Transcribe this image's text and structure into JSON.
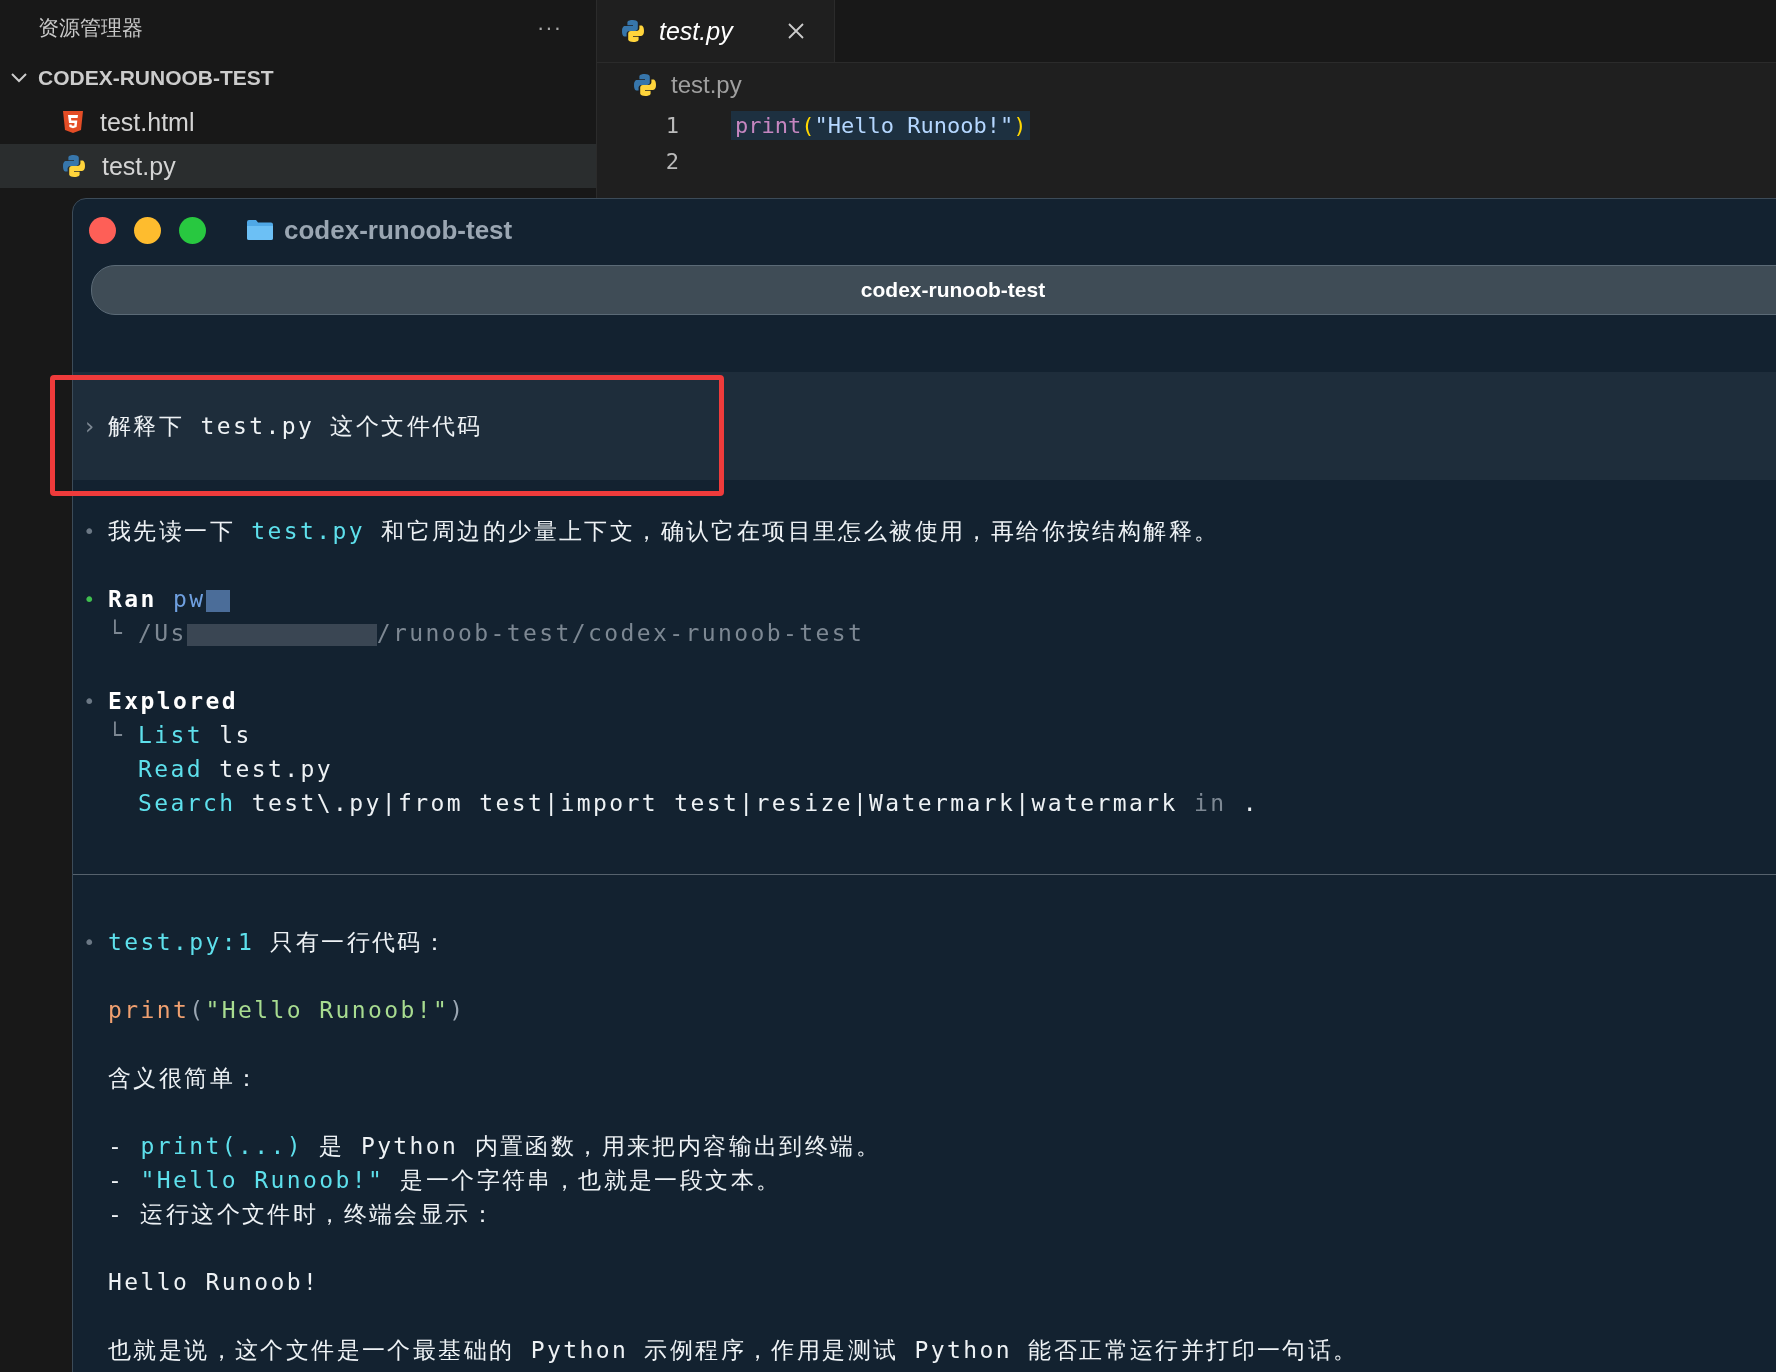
{
  "sidebar": {
    "title": "资源管理器",
    "more": "···",
    "folder": {
      "name": "CODEX-RUNOOB-TEST",
      "expanded": true
    },
    "files": [
      {
        "name": "test.html",
        "kind": "html",
        "selected": false
      },
      {
        "name": "test.py",
        "kind": "python",
        "selected": true
      }
    ]
  },
  "editor": {
    "tab": {
      "label": "test.py"
    },
    "breadcrumb": "test.py",
    "lines": [
      {
        "number": "1",
        "segments": [
          {
            "text": "print",
            "kind": "func"
          },
          {
            "text": "(",
            "kind": "paren"
          },
          {
            "text": "\"Hello Runoob!\"",
            "kind": "string"
          },
          {
            "text": ")",
            "kind": "paren"
          }
        ]
      },
      {
        "number": "2"
      }
    ]
  },
  "terminal": {
    "title": "codex-runoob-test",
    "tab": "codex-runoob-test",
    "blocks": [
      {
        "kind": "prompt",
        "marker": "›",
        "lines": [
          {
            "segments": [
              {
                "text": "解释下 test.py 这个文件代码",
                "kind": "plain"
              }
            ]
          }
        ]
      },
      {
        "kind": "bullet",
        "marker": "•",
        "color": "#6b7885",
        "lines": [
          {
            "segments": [
              {
                "text": "我先读一下 ",
                "kind": "plain"
              },
              {
                "text": "test.py",
                "kind": "accent"
              },
              {
                "text": " 和它周边的少量上下文，确认它在项目里怎么被使用，再给你按结构解释。",
                "kind": "plain"
              }
            ]
          }
        ]
      },
      {
        "kind": "bullet",
        "marker": "•",
        "color": "#3fbf4f",
        "lines": [
          {
            "segments": [
              {
                "text": "Ran",
                "kind": "bold"
              },
              {
                "text": " pw",
                "kind": "command"
              },
              {
                "kind": "redacted"
              }
            ]
          },
          {
            "tree": "└",
            "segments": [
              {
                "text": "/Us",
                "kind": "dim"
              },
              {
                "kind": "redacted"
              },
              {
                "text": "/runoob-test/codex-runoob-test",
                "kind": "dim"
              }
            ]
          }
        ]
      },
      {
        "kind": "bullet",
        "marker": "•",
        "color": "#6b7885",
        "lines": [
          {
            "segments": [
              {
                "text": "Explored",
                "kind": "bold"
              }
            ]
          },
          {
            "tree": "└",
            "segments": [
              {
                "text": "List",
                "kind": "accent"
              },
              {
                "text": " ls",
                "kind": "plain"
              }
            ]
          },
          {
            "segments": [
              {
                "text": "Read",
                "kind": "accent"
              },
              {
                "text": " test.py",
                "kind": "plain"
              }
            ]
          },
          {
            "segments": [
              {
                "text": "Search",
                "kind": "accent"
              },
              {
                "text": " test\\.py|from test|import test|resize|Watermark|watermark ",
                "kind": "plain"
              },
              {
                "text": "in",
                "kind": "dim"
              },
              {
                "text": " .",
                "kind": "plain"
              }
            ]
          }
        ]
      },
      {
        "kind": "divider"
      },
      {
        "kind": "bullet",
        "marker": "•",
        "color": "#6b7885",
        "lines": [
          {
            "segments": [
              {
                "text": "test.py:1",
                "kind": "accent"
              },
              {
                "text": " 只有一行代码：",
                "kind": "plain"
              }
            ]
          }
        ]
      },
      {
        "kind": "text",
        "lines": [
          {
            "segments": [
              {
                "text": "print",
                "kind": "func"
              },
              {
                "text": "(",
                "kind": "paren"
              },
              {
                "text": "\"Hello Runoob!\"",
                "kind": "string"
              },
              {
                "text": ")",
                "kind": "paren"
              }
            ]
          }
        ]
      },
      {
        "kind": "text",
        "lines": [
          {
            "segments": [
              {
                "text": "含义很简单：",
                "kind": "plain"
              }
            ]
          }
        ]
      },
      {
        "kind": "text",
        "lines": [
          {
            "segments": [
              {
                "text": "- ",
                "kind": "plain"
              },
              {
                "text": "print(...)",
                "kind": "accent"
              },
              {
                "text": " 是 Python 内置函数，用来把内容输出到终端。",
                "kind": "plain"
              }
            ]
          },
          {
            "segments": [
              {
                "text": "- ",
                "kind": "plain"
              },
              {
                "text": "\"Hello Runoob!\"",
                "kind": "accent"
              },
              {
                "text": " 是一个字符串，也就是一段文本。",
                "kind": "plain"
              }
            ]
          },
          {
            "segments": [
              {
                "text": "- 运行这个文件时，终端会显示：",
                "kind": "plain"
              }
            ]
          }
        ]
      },
      {
        "kind": "text",
        "lines": [
          {
            "segments": [
              {
                "text": "Hello Runoob!",
                "kind": "plain"
              }
            ]
          }
        ]
      },
      {
        "kind": "text",
        "lines": [
          {
            "segments": [
              {
                "text": "也就是说，这个文件是一个最基础的 Python 示例程序，作用是测试 Python 能否正常运行并打印一句话。",
                "kind": "plain"
              }
            ]
          }
        ]
      }
    ]
  }
}
